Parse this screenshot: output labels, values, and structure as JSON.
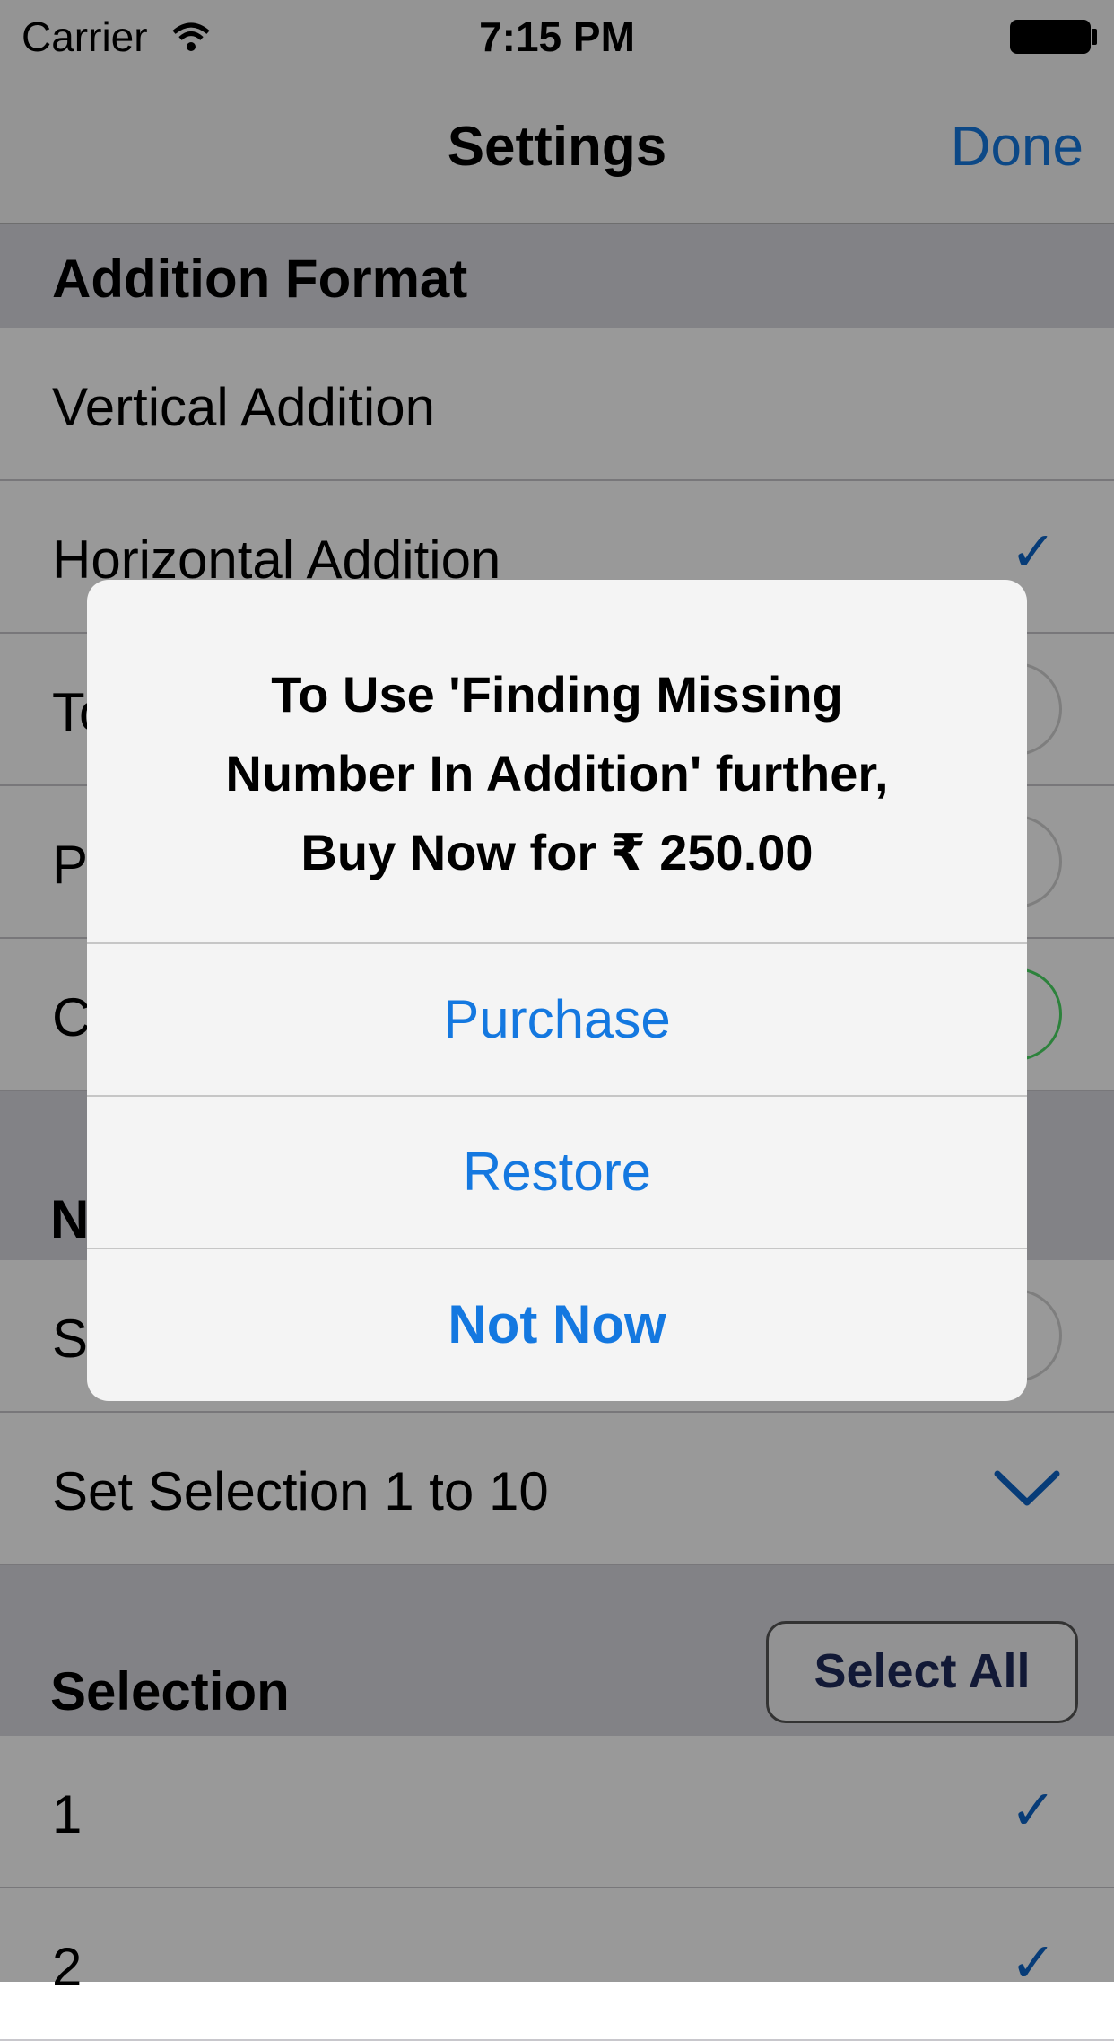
{
  "status_bar": {
    "carrier": "Carrier",
    "time": "7:15 PM"
  },
  "nav": {
    "title": "Settings",
    "done_label": "Done"
  },
  "addition_format": {
    "header": "Addition Format",
    "items": [
      {
        "label": "Vertical Addition",
        "checked": false
      },
      {
        "label": "Horizontal Addition",
        "checked": true
      },
      {
        "label": "To",
        "checked": false
      },
      {
        "label": "P",
        "checked": false
      },
      {
        "label": "C",
        "checked": false
      }
    ]
  },
  "number_selection": {
    "header": "N",
    "items": [
      {
        "label": "S"
      },
      {
        "label": "Set Selection 1 to 10"
      }
    ]
  },
  "selection": {
    "header": "Selection",
    "select_all_label": "Select All",
    "items": [
      {
        "label": "1",
        "checked": true
      },
      {
        "label": "2",
        "checked": true
      }
    ]
  },
  "alert": {
    "message_line1": "To Use 'Finding Missing",
    "message_line2": "Number In Addition' further,",
    "message_line3": "Buy Now for ₹ 250.00",
    "buttons": {
      "purchase": "Purchase",
      "restore": "Restore",
      "not_now": "Not Now"
    }
  },
  "colors": {
    "accent": "#1478e0",
    "check": "#0d64c8",
    "toggle_on": "#4cd964"
  }
}
